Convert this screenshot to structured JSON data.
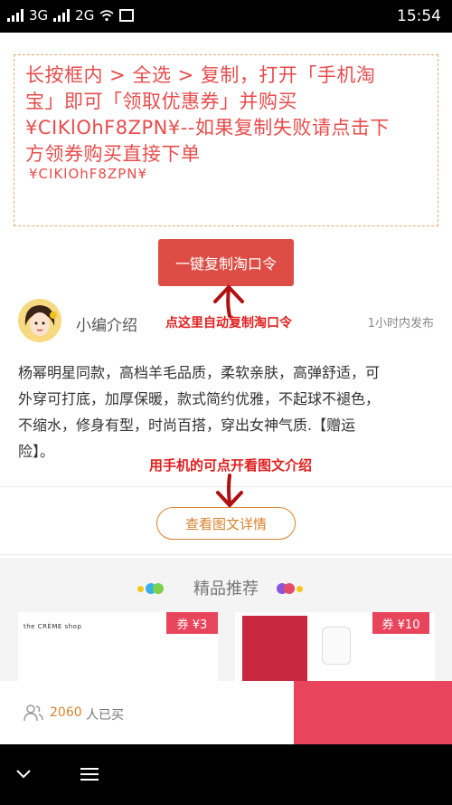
{
  "status_bar": {
    "network1": "3G",
    "network2": "2G",
    "time": "15:54"
  },
  "coupon": {
    "line1": "长按框内 > 全选 > 复制，打开「手机淘",
    "line2": "宝」即可「领取优惠券」并购买",
    "line3": "¥CIKlOhF8ZPN¥--如果复制失败请点击下",
    "line4": "方领券购买直接下单",
    "code": "¥CIKlOhF8ZPN¥"
  },
  "copy_button_label": "一键复制淘口令",
  "hint_copy": "点这里自动复制淘口令",
  "intro": {
    "title": "小编介绍",
    "time": "1小时内发布",
    "desc_lines": [
      "杨幂明星同款，高档羊毛品质，柔软亲肤，高弹舒适，可",
      "外穿可打底，加厚保暖，款式简约优雅，不起球不褪色，",
      "不缩水，修身有型，时尚百搭，穿出女神气质.【赠运",
      "险】。"
    ]
  },
  "hint_detail": "用手机的可点开看图文介绍",
  "detail_button_label": "查看图文详情",
  "recommend": {
    "title": "精品推荐",
    "cards": [
      {
        "brand": "the CRÈME shop",
        "coupon": "券 ¥3"
      },
      {
        "brand": "",
        "coupon": "券 ¥10"
      }
    ]
  },
  "buy_bar": {
    "count": "2060",
    "label": "人已买"
  },
  "colors": {
    "accent_red": "#dd4d45",
    "coupon_pink": "#e8455d",
    "orange": "#d9822b",
    "hint_red": "#e02020"
  }
}
